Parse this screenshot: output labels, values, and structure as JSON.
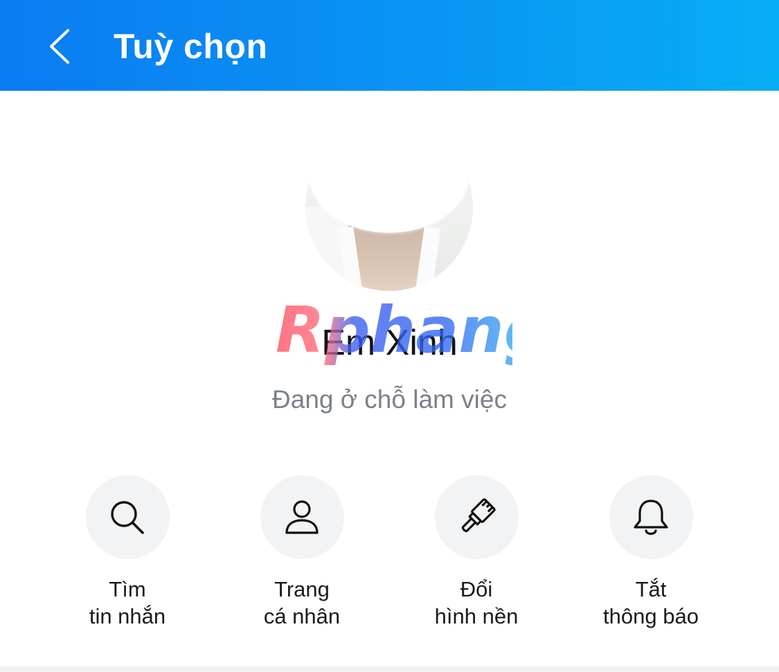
{
  "header": {
    "title": "Tuỳ chọn",
    "back_icon": "chevron-left-icon",
    "colors": {
      "gradient_start": "#0a7cf2",
      "gradient_end": "#06aef4"
    }
  },
  "profile": {
    "name": "Em Xinh",
    "status": "Đang ở chỗ làm việc"
  },
  "watermark": {
    "text": "Rphang"
  },
  "actions": [
    {
      "icon": "search-icon",
      "line1": "Tìm",
      "line2": "tin nhắn"
    },
    {
      "icon": "user-icon",
      "line1": "Trang",
      "line2": "cá nhân"
    },
    {
      "icon": "paint-brush-icon",
      "line1": "Đổi",
      "line2": "hình nền"
    },
    {
      "icon": "bell-icon",
      "line1": "Tắt",
      "line2": "thông báo"
    }
  ]
}
